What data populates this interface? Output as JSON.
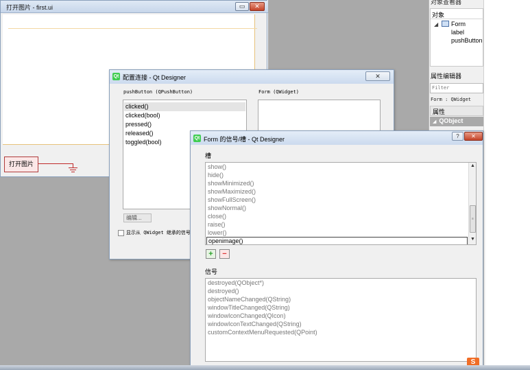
{
  "background_window": {
    "title": "打开图片 - first.ui",
    "min_label": "▭",
    "close_label": "✕",
    "button_text": "打开图片"
  },
  "right_panel": {
    "object_inspector_title": "对象查看器",
    "object_header": "对象",
    "tree": {
      "expand_arrow": "◢",
      "form": "Form",
      "label": "label",
      "pushbutton": "pushButton"
    },
    "property_editor_title": "属性编辑器",
    "filter_placeholder": "Filter",
    "class_line": "Form : QWidget",
    "property_header": "属性",
    "qobject_arrow": "◢",
    "qobject_section": "QObject"
  },
  "config_dialog": {
    "icon_text": "Qt",
    "title": "配置连接 - Qt Designer",
    "close_label": "✕",
    "sender_label": "pushButton (QPushButton)",
    "receiver_label": "Form (QWidget)",
    "signals": [
      "clicked()",
      "clicked(bool)",
      "pressed()",
      "released()",
      "toggled(bool)"
    ],
    "edit_button": "编辑...",
    "inherit_checkbox": "显示从 QWidget 继承的信号和槽"
  },
  "signals_slots_dialog": {
    "icon_text": "Qt",
    "title": "Form 的信号/槽 - Qt Designer",
    "help_label": "?",
    "close_label": "✕",
    "slots_heading": "槽",
    "slots": [
      "show()",
      "hide()",
      "showMinimized()",
      "showMaximized()",
      "showFullScreen()",
      "showNormal()",
      "close()",
      "raise()",
      "lower()"
    ],
    "selected_slot": "openimage()",
    "scroll_up": "▲",
    "scroll_grip": "≡",
    "scroll_down": "▼",
    "add_label": "+",
    "remove_label": "−",
    "signals_heading": "信号",
    "signals": [
      "destroyed(QObject*)",
      "destroyed()",
      "objectNameChanged(QString)",
      "windowTitleChanged(QString)",
      "windowIconChanged(QIcon)",
      "windowIconTextChanged(QString)",
      "customContextMenuRequested(QPoint)"
    ],
    "ime_badge": "S"
  },
  "colors": {
    "accent_red": "#c02828",
    "qt_green": "#41cd52",
    "gray_area": "#a9a9a9"
  }
}
